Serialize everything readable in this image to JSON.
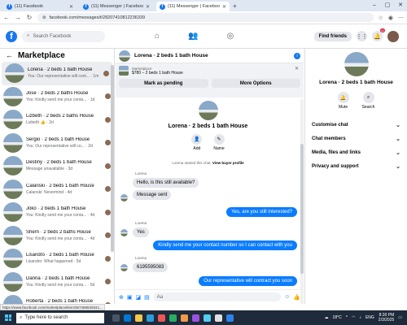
{
  "browser": {
    "tabs": [
      {
        "title": "(11) Facebook",
        "active": false
      },
      {
        "title": "(11) Messenger | Facebook",
        "active": false
      },
      {
        "title": "(11) Messenger | Facebook",
        "active": true
      }
    ],
    "url": "facebook.com/messages/t/28207410812236339",
    "status_url": "https://www.facebook.com/marketplace/item/367468629341..."
  },
  "header": {
    "search_placeholder": "Search Facebook",
    "find_friends": "Find friends",
    "notification_count": "11"
  },
  "sidebar": {
    "title": "Marketplace",
    "conversations": [
      {
        "name": "Lorena · 2 beds 1 bath House",
        "snippet": "You: Our representative will cont...",
        "time": "1m",
        "active": true
      },
      {
        "name": "Jose · 2 beds 2 baths House",
        "snippet": "You: Kindly send me your conta...",
        "time": "1d",
        "active": false
      },
      {
        "name": "Lizbeth · 2 beds 2 baths House",
        "snippet": "Lizbeth 👍",
        "time": "2d",
        "active": false
      },
      {
        "name": "Sergio · 2 beds 1 bath House",
        "snippet": "You: Our representative will co...",
        "time": "2d",
        "active": false
      },
      {
        "name": "Destiny · 2 beds 1 bath House",
        "snippet": "Message unavailable",
        "time": "3d",
        "active": false
      },
      {
        "name": "Calanski · 2 beds 1 bath House",
        "snippet": "Calanski: Nevermind",
        "time": "4d",
        "active": false
      },
      {
        "name": "Joko · 2 beds 1 bath House",
        "snippet": "You: Kindly send me your conta...",
        "time": "4d",
        "active": false
      },
      {
        "name": "Shern · 2 beds 2 baths House",
        "snippet": "You: Kindly send me your conta...",
        "time": "4d",
        "active": false
      },
      {
        "name": "Lisandro · 2 beds 1 bath House",
        "snippet": "Lisandro: What happened",
        "time": "5d",
        "active": false
      },
      {
        "name": "Danna · 2 beds 1 bath House",
        "snippet": "You: Kindly send me your conta...",
        "time": "5d",
        "active": false
      },
      {
        "name": "Roberta · 2 beds 1 bath House",
        "snippet": "You: ok",
        "time": "5d",
        "active": false
      }
    ]
  },
  "chat": {
    "title": "Lorena · 2 beds 1 bath House",
    "listing_label": "Marketplace",
    "listing_price": "$780 – 2 beds 1 bath House",
    "mark_pending": "Mark as pending",
    "more_options": "More Options",
    "profile_name": "Lorena · 2 beds 1 bath House",
    "add_label": "Add",
    "name_label": "Name",
    "system_text": "Lorena started this chat.",
    "system_link": "View buyer profile",
    "sender_name": "Lorena",
    "messages": [
      {
        "from": "in",
        "text": "Hello, is this still available?"
      },
      {
        "from": "in",
        "text": "Message sent"
      },
      {
        "from": "out",
        "text": "Yes, are you still interested?"
      },
      {
        "from": "in",
        "text": "Yes"
      },
      {
        "from": "out",
        "text": "Kindly send me your contact number so I can contact with you"
      },
      {
        "from": "in",
        "text": "6195595083"
      },
      {
        "from": "out",
        "text": "Our representative will contract you soon"
      }
    ],
    "composer_placeholder": "Aa"
  },
  "right_panel": {
    "name": "Lorena · 2 beds 1 bath House",
    "mute": "Mute",
    "search": "Search",
    "sections": [
      "Customise chat",
      "Chat members",
      "Media, files and links",
      "Privacy and support"
    ]
  },
  "taskbar": {
    "search_placeholder": "Type here to search",
    "weather": "18°C",
    "lang": "ENG",
    "time": "8:30 PM",
    "date": "2/3/2025"
  }
}
